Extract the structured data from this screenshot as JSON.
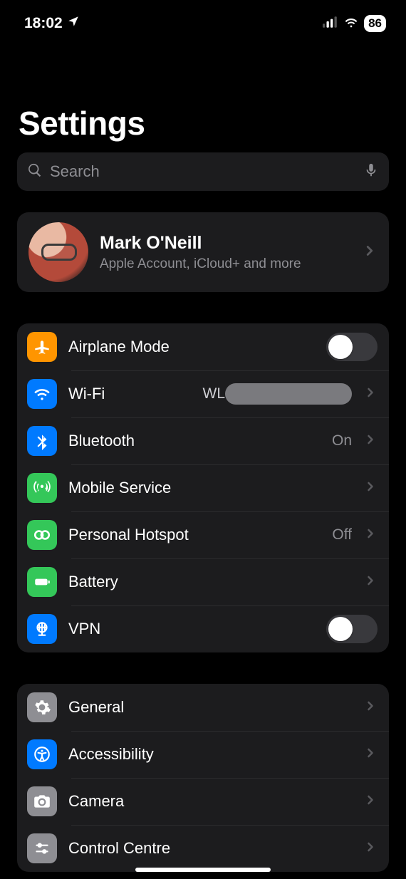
{
  "status": {
    "time": "18:02",
    "battery": "86"
  },
  "title": "Settings",
  "search": {
    "placeholder": "Search"
  },
  "account": {
    "name": "Mark O'Neill",
    "subtitle": "Apple Account, iCloud+ and more"
  },
  "connectivity": {
    "airplane": {
      "label": "Airplane Mode",
      "on": false
    },
    "wifi": {
      "label": "Wi-Fi",
      "value_prefix": "WL"
    },
    "bluetooth": {
      "label": "Bluetooth",
      "value": "On"
    },
    "mobile": {
      "label": "Mobile Service"
    },
    "hotspot": {
      "label": "Personal Hotspot",
      "value": "Off"
    },
    "battery": {
      "label": "Battery"
    },
    "vpn": {
      "label": "VPN",
      "on": false
    }
  },
  "system": {
    "general": {
      "label": "General"
    },
    "accessibility": {
      "label": "Accessibility"
    },
    "camera": {
      "label": "Camera"
    },
    "controlcentre": {
      "label": "Control Centre"
    }
  }
}
